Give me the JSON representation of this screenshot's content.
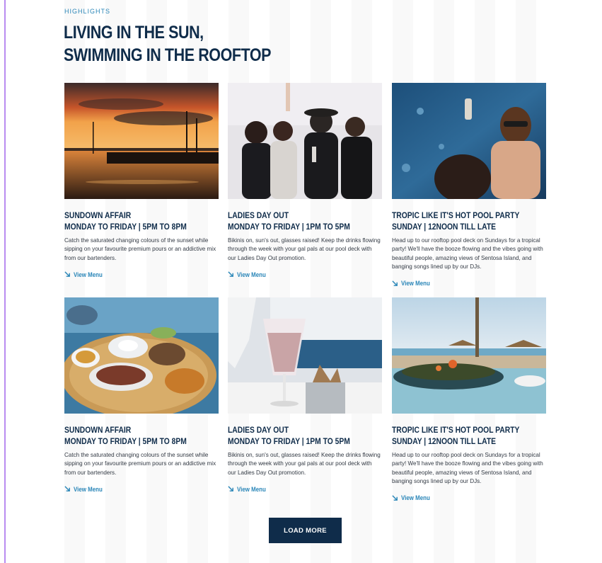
{
  "section": {
    "eyebrow": "HIGHLIGHTS",
    "headline_line1": "LIVING IN THE SUN,",
    "headline_line2": "SWIMMING IN THE ROOFTOP"
  },
  "cards": [
    {
      "title_line1": "SUNDOWN AFFAIR",
      "title_line2": "MONDAY TO FRIDAY | 5PM TO 8PM",
      "description": "Catch the saturated changing colours of the sunset while sipping on your favourite premium pours or an addictive mix from our bartenders.",
      "link": "View Menu",
      "image_icon": "sunset-photo"
    },
    {
      "title_line1": "LADIES DAY OUT",
      "title_line2": "MONDAY TO FRIDAY | 1PM TO 5PM",
      "description": "Bikinis on, sun's out, glasses raised! Keep the drinks flowing through the week with your gal pals at our pool deck with our Ladies Day Out promotion.",
      "link": "View Menu",
      "image_icon": "party-photo"
    },
    {
      "title_line1": "TROPIC LIKE IT'S HOT POOL PARTY",
      "title_line2": "SUNDAY | 12NOON TILL LATE",
      "description": "Head up to our rooftop pool deck on Sundays for a tropical party! We'll have the booze flowing and the vibes going with beautiful people, amazing views of Sentosa Island, and banging songs lined up by our DJs.",
      "link": "View Menu",
      "image_icon": "pool-photo"
    },
    {
      "title_line1": "SUNDOWN AFFAIR",
      "title_line2": "MONDAY TO FRIDAY | 5PM TO 8PM",
      "description": "Catch the saturated changing colours of the sunset while sipping on your favourite premium pours or an addictive mix from our bartenders.",
      "link": "View Menu",
      "image_icon": "food-platter-photo"
    },
    {
      "title_line1": "LADIES DAY OUT",
      "title_line2": "MONDAY TO FRIDAY | 1PM TO 5PM",
      "description": "Bikinis on, sun's out, glasses raised! Keep the drinks flowing through the week with your gal pals at our pool deck with our Ladies Day Out promotion.",
      "link": "View Menu",
      "image_icon": "cocktail-photo"
    },
    {
      "title_line1": "TROPIC LIKE IT'S HOT POOL PARTY",
      "title_line2": "SUNDAY | 12NOON TILL LATE",
      "description": "Head up to our rooftop pool deck on Sundays for a tropical party! We'll have the booze flowing and the vibes going with beautiful people, amazing views of Sentosa Island, and banging songs lined up by our DJs.",
      "link": "View Menu",
      "image_icon": "beach-bowl-photo"
    }
  ],
  "load_more": "LOAD MORE",
  "colors": {
    "navy": "#0f2c4a",
    "link_blue": "#2a86b8",
    "accent_rule": "#b98cf0"
  }
}
